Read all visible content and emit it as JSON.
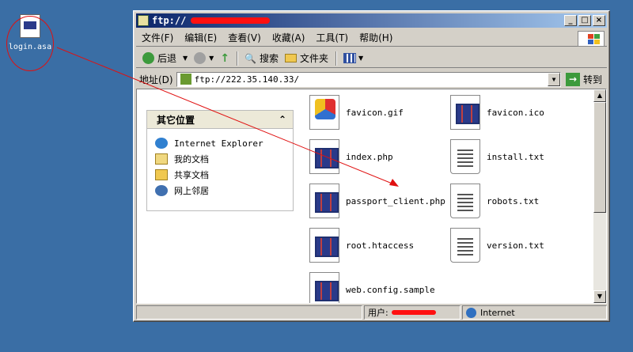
{
  "desktop": {
    "icon_label": "login.asa"
  },
  "window": {
    "title": "ftp://",
    "buttons": {
      "minimize": "_",
      "maximize": "□",
      "close": "×"
    }
  },
  "menu": [
    "文件(F)",
    "编辑(E)",
    "查看(V)",
    "收藏(A)",
    "工具(T)",
    "帮助(H)"
  ],
  "toolbar": {
    "back": "后退",
    "search": "搜索",
    "folders": "文件夹"
  },
  "address": {
    "label": "地址(D)",
    "value": "ftp://222.35.140.33/",
    "go": "转到"
  },
  "sidebar": {
    "panel_title": "其它位置",
    "items": [
      "Internet Explorer",
      "我的文档",
      "共享文档",
      "网上邻居"
    ]
  },
  "files": [
    {
      "name": "favicon.gif",
      "type": "gif"
    },
    {
      "name": "favicon.ico",
      "type": "php"
    },
    {
      "name": "index.php",
      "type": "php"
    },
    {
      "name": "install.txt",
      "type": "txt"
    },
    {
      "name": "passport_client.php",
      "type": "php"
    },
    {
      "name": "robots.txt",
      "type": "txt"
    },
    {
      "name": "root.htaccess",
      "type": "php"
    },
    {
      "name": "version.txt",
      "type": "txt"
    },
    {
      "name": "web.config.sample",
      "type": "php"
    }
  ],
  "status": {
    "user_label": "用户:",
    "zone": "Internet"
  }
}
